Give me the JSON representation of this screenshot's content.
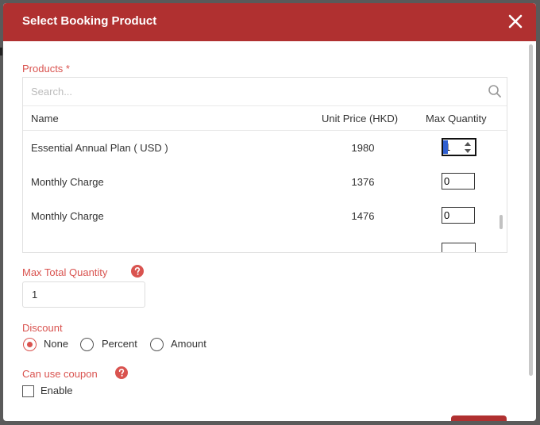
{
  "modal": {
    "title": "Select Booking Product"
  },
  "products": {
    "label": "Products *",
    "search_placeholder": "Search...",
    "columns": {
      "name": "Name",
      "unit_price": "Unit Price (HKD)",
      "max_quantity": "Max Quantity"
    },
    "rows": [
      {
        "name": "Essential Annual Plan ( USD )",
        "price": "1980",
        "qty": "1"
      },
      {
        "name": "Monthly Charge",
        "price": "1376",
        "qty": "0"
      },
      {
        "name": "Monthly Charge",
        "price": "1476",
        "qty": "0"
      }
    ]
  },
  "max_total_quantity": {
    "label": "Max Total Quantity",
    "value": "1"
  },
  "discount": {
    "label": "Discount",
    "options": [
      {
        "label": "None",
        "selected": true
      },
      {
        "label": "Percent",
        "selected": false
      },
      {
        "label": "Amount",
        "selected": false
      }
    ]
  },
  "coupon": {
    "label": "Can use coupon",
    "checkbox_label": "Enable",
    "checked": false
  },
  "colors": {
    "header": "#b03030",
    "label_accent": "#d9534f"
  }
}
